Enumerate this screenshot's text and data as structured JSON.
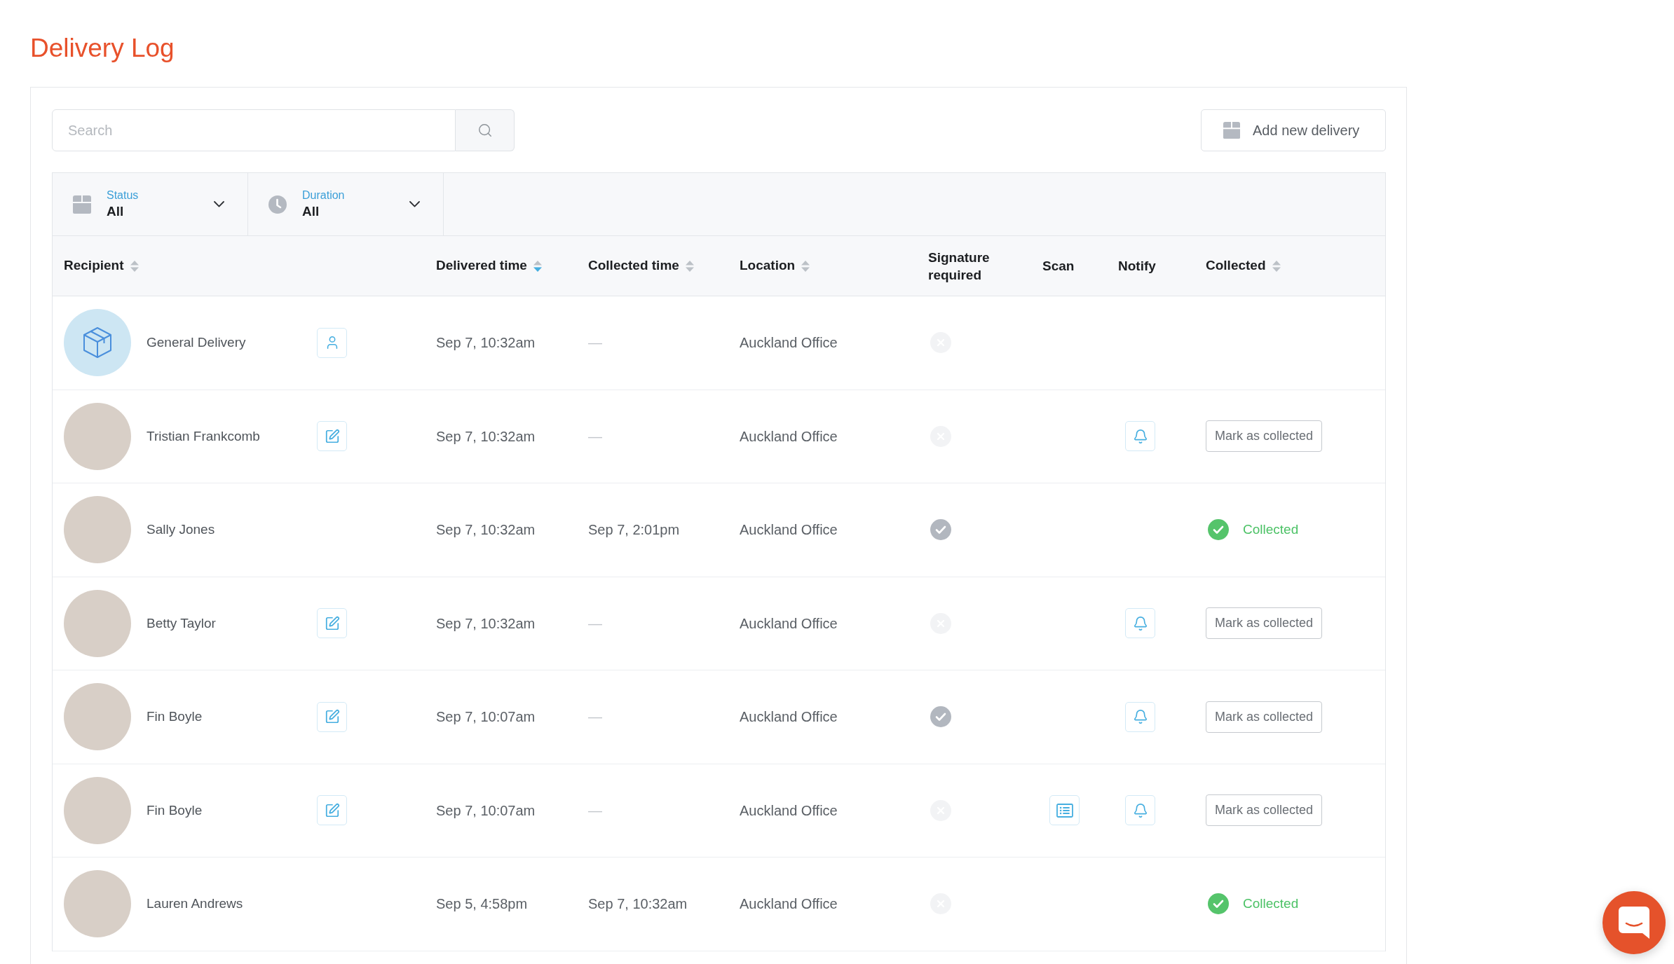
{
  "page": {
    "title": "Delivery Log"
  },
  "search": {
    "placeholder": "Search"
  },
  "add_button": {
    "label": "Add new delivery"
  },
  "filters": [
    {
      "kind": "status",
      "label": "Status",
      "value": "All"
    },
    {
      "kind": "duration",
      "label": "Duration",
      "value": "All"
    }
  ],
  "columns": [
    {
      "label": "Recipient",
      "sortable": true,
      "sorted": false
    },
    {
      "label": "Delivered time",
      "sortable": true,
      "sorted": true
    },
    {
      "label": "Collected time",
      "sortable": true,
      "sorted": false
    },
    {
      "label": "Location",
      "sortable": true,
      "sorted": false
    },
    {
      "label": "Signature required",
      "sortable": false
    },
    {
      "label": "Scan",
      "sortable": false
    },
    {
      "label": "Notify",
      "sortable": false
    },
    {
      "label": "Collected",
      "sortable": true,
      "sorted": false
    }
  ],
  "rows": [
    {
      "kind": "package",
      "name": "General Delivery",
      "action": {
        "kind": "user"
      },
      "delivered_time": "Sep 7, 10:32am",
      "collected_time": "—",
      "collected_time_muted": true,
      "location": "Auckland Office",
      "signature_required": false,
      "scan": false,
      "notify": false
    },
    {
      "kind": "person",
      "name": "Tristian Frankcomb",
      "action": {
        "kind": "edit"
      },
      "delivered_time": "Sep 7, 10:32am",
      "collected_time": "—",
      "collected_time_muted": true,
      "location": "Auckland Office",
      "signature_required": false,
      "scan": false,
      "notify": true,
      "collected": {
        "kind": "button",
        "label": "Mark as collected"
      }
    },
    {
      "kind": "person",
      "name": "Sally Jones",
      "delivered_time": "Sep 7, 10:32am",
      "collected_time": "Sep 7, 2:01pm",
      "collected_time_muted": false,
      "location": "Auckland Office",
      "signature_required": true,
      "scan": false,
      "notify": false,
      "collected": {
        "kind": "status",
        "label": "Collected"
      }
    },
    {
      "kind": "person",
      "name": "Betty Taylor",
      "action": {
        "kind": "edit"
      },
      "delivered_time": "Sep 7, 10:32am",
      "collected_time": "—",
      "collected_time_muted": true,
      "location": "Auckland Office",
      "signature_required": false,
      "scan": false,
      "notify": true,
      "collected": {
        "kind": "button",
        "label": "Mark as collected"
      }
    },
    {
      "kind": "person",
      "name": "Fin Boyle",
      "action": {
        "kind": "edit"
      },
      "delivered_time": "Sep 7, 10:07am",
      "collected_time": "—",
      "collected_time_muted": true,
      "location": "Auckland Office",
      "signature_required": true,
      "scan": false,
      "notify": true,
      "collected": {
        "kind": "button",
        "label": "Mark as collected"
      }
    },
    {
      "kind": "person",
      "name": "Fin Boyle",
      "action": {
        "kind": "edit"
      },
      "delivered_time": "Sep 7, 10:07am",
      "collected_time": "—",
      "collected_time_muted": true,
      "location": "Auckland Office",
      "signature_required": false,
      "scan": true,
      "notify": true,
      "collected": {
        "kind": "button",
        "label": "Mark as collected"
      }
    },
    {
      "kind": "person",
      "name": "Lauren Andrews",
      "delivered_time": "Sep 5, 4:58pm",
      "collected_time": "Sep 7, 10:32am",
      "collected_time_muted": false,
      "location": "Auckland Office",
      "signature_required": false,
      "scan": false,
      "notify": false,
      "collected": {
        "kind": "status",
        "label": "Collected"
      }
    }
  ]
}
